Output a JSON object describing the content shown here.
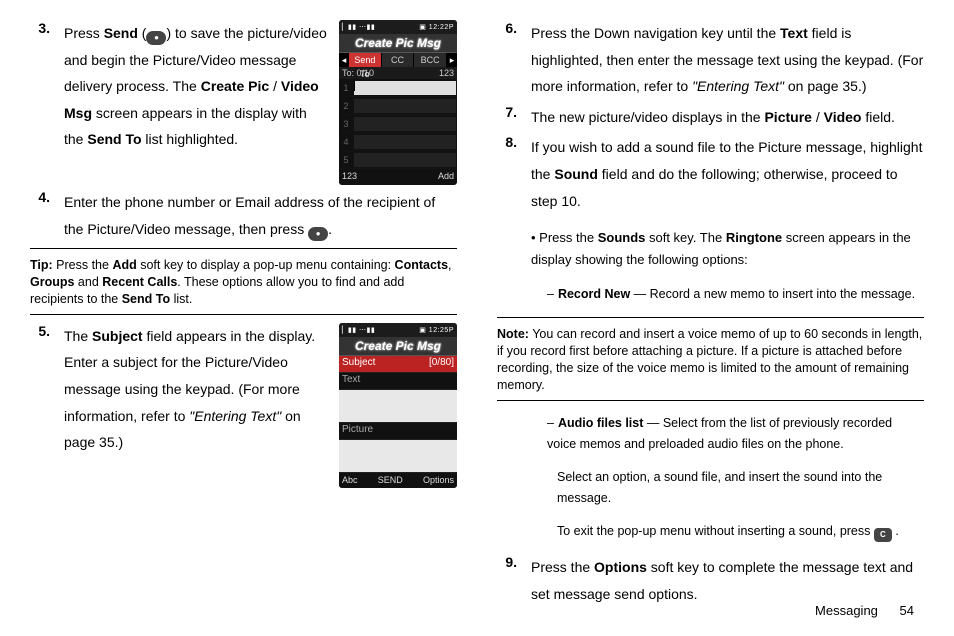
{
  "footer": {
    "section": "Messaging",
    "page": "54"
  },
  "left": {
    "steps": [
      {
        "n": "3.",
        "text_parts": [
          "Press ",
          "Send",
          " (",
          ") to save the picture/video and begin the Picture/Video message delivery process. The ",
          "Create Pic",
          " / ",
          "Video Msg",
          " screen appears in the display with the ",
          "Send To",
          " list highlighted."
        ],
        "key": "●"
      },
      {
        "n": "4.",
        "text_parts": [
          "Enter the phone number or Email address of the recipient of the Picture/Video message, then press ",
          "."
        ],
        "key": "●"
      },
      {
        "n": "5.",
        "text_parts": [
          "The ",
          "Subject",
          " field appears in the display. Enter a subject for the Picture/Video message using the keypad. (For more information, refer to ",
          "\"Entering Text\"",
          "  on page 35.)"
        ]
      }
    ],
    "tip": {
      "label": "Tip:",
      "parts": [
        " Press the ",
        "Add",
        " soft key to display a pop-up menu containing: ",
        "Contacts",
        ", ",
        "Groups",
        " and ",
        "Recent Calls",
        ". These options allow you to find and add recipients to the ",
        "Send To",
        " list."
      ]
    },
    "shot1": {
      "title": "Create Pic Msg",
      "tabs": [
        "Send To",
        "CC",
        "BCC"
      ],
      "to": "To:  0/10",
      "mode": "123",
      "soft": [
        "123",
        "",
        "Add"
      ],
      "slots": [
        "1",
        "2",
        "3",
        "4",
        "5"
      ]
    },
    "shot2": {
      "title": "Create Pic Msg",
      "rows": [
        {
          "label": "Subject",
          "right": "[0/80]",
          "hi": true
        },
        {
          "label": "Text",
          "big": false
        },
        {
          "label": "",
          "big": true
        },
        {
          "label": "Picture",
          "big": false
        },
        {
          "label": "",
          "big": true
        }
      ],
      "soft": [
        "Abc",
        "SEND",
        "Options"
      ]
    }
  },
  "right": {
    "steps": [
      {
        "n": "6.",
        "parts": [
          "Press the Down navigation key until the ",
          "Text",
          " field is highlighted, then enter the message text using the keypad. (For more information, refer to ",
          "\"Entering Text\"",
          "  on page 35.)"
        ]
      },
      {
        "n": "7.",
        "parts": [
          "The new picture/video displays in the ",
          "Picture",
          " / ",
          "Video",
          " field."
        ]
      },
      {
        "n": "8.",
        "parts": [
          "If you wish to add a sound file to the Picture message, highlight the ",
          "Sound",
          " field and do the following; otherwise, proceed to step 10."
        ]
      }
    ],
    "bullet": {
      "parts": [
        "Press the ",
        "Sounds",
        " soft key. The ",
        "Ringtone",
        " screen appears in the display showing the following options:"
      ]
    },
    "dash1": {
      "bold": "Record New",
      "rest": " — Record a new memo to insert into the message."
    },
    "note": {
      "label": "Note:",
      "text": " You can record and insert a voice memo of up to 60 seconds in length, if you record first before attaching a picture. If a picture is attached before recording, the size of the voice memo is limited to the amount of remaining memory."
    },
    "dash2": {
      "bold": "Audio files list",
      "rest": " — Select from the list of previously recorded voice memos and preloaded audio files on the phone."
    },
    "extra1": "Select an option, a sound file, and insert the sound into the message.",
    "extra2_pre": "To exit the pop-up menu without inserting a sound, press ",
    "extra2_post": " .",
    "step9": {
      "n": "9.",
      "parts": [
        "Press the ",
        "Options",
        " soft key to complete the message text and set message send options."
      ]
    }
  }
}
